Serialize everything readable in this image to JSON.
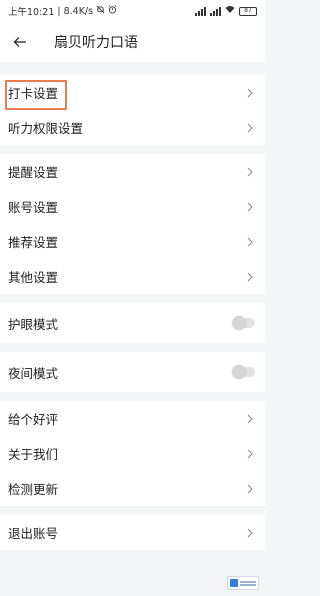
{
  "statusbar": {
    "time": "上午10:21",
    "separator": "|",
    "speed": "8.4K/s",
    "battery": "87"
  },
  "header": {
    "title": "扇贝听力口语"
  },
  "groups": [
    {
      "items": [
        {
          "label": "打卡设置"
        },
        {
          "label": "听力权限设置"
        }
      ]
    },
    {
      "items": [
        {
          "label": "提醒设置"
        },
        {
          "label": "账号设置"
        },
        {
          "label": "推荐设置"
        },
        {
          "label": "其他设置"
        }
      ]
    },
    {
      "toggle": {
        "label": "护眼模式",
        "on": false
      }
    },
    {
      "toggle": {
        "label": "夜间模式",
        "on": false
      }
    },
    {
      "items": [
        {
          "label": "给个好评"
        },
        {
          "label": "关于我们"
        },
        {
          "label": "检测更新"
        }
      ]
    },
    {
      "items": [
        {
          "label": "退出账号"
        }
      ]
    }
  ],
  "colors": {
    "highlight_border": "#ee7b53",
    "page_background": "#f4f5f7"
  }
}
